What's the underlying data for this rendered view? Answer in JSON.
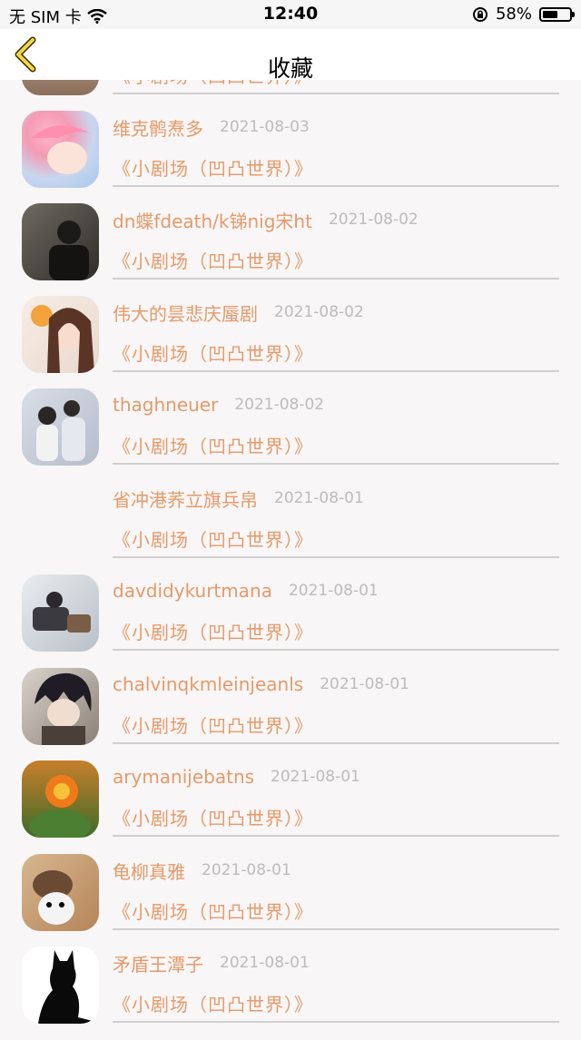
{
  "status_bar": {
    "carrier": "无 SIM 卡",
    "time": "12:40",
    "battery": "58%",
    "battery_level": 0.58
  },
  "nav": {
    "title": "收藏"
  },
  "items": [
    {
      "name": "",
      "date": "",
      "show": "《小剧场（凹凸世界）》"
    },
    {
      "name": "维克鹘焘多",
      "date": "2021-08-03",
      "show": "《小剧场（凹凸世界）》"
    },
    {
      "name": "dn蝶fdeath/k锑nig宋ht",
      "date": "2021-08-02",
      "show": "《小剧场（凹凸世界）》"
    },
    {
      "name": "伟大的昙悲庆蜃剧",
      "date": "2021-08-02",
      "show": "《小剧场（凹凸世界）》"
    },
    {
      "name": "thaghneuer",
      "date": "2021-08-02",
      "show": "《小剧场（凹凸世界）》"
    },
    {
      "name": "省冲港荞立旗兵帛",
      "date": "2021-08-01",
      "show": "《小剧场（凹凸世界）》"
    },
    {
      "name": "davdidykurtmana",
      "date": "2021-08-01",
      "show": "《小剧场（凹凸世界）》"
    },
    {
      "name": "chalvinqkmleinjeanls",
      "date": "2021-08-01",
      "show": "《小剧场（凹凸世界）》"
    },
    {
      "name": "arymanijebatns",
      "date": "2021-08-01",
      "show": "《小剧场（凹凸世界）》"
    },
    {
      "name": "龟柳真雅",
      "date": "2021-08-01",
      "show": "《小剧场（凹凸世界）》"
    },
    {
      "name": "矛盾王潭子",
      "date": "2021-08-01",
      "show": "《小剧场（凹凸世界）》"
    }
  ]
}
